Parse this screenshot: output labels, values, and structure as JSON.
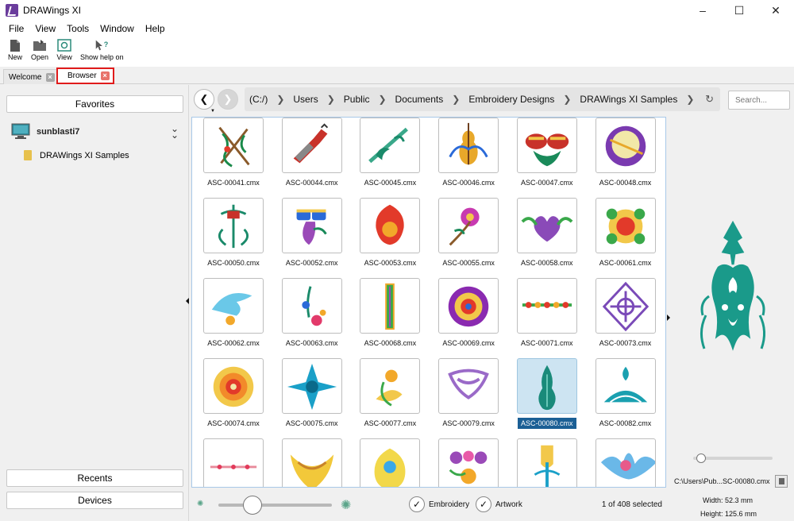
{
  "window": {
    "title": "DRAWings XI",
    "controls": [
      "minimize-icon",
      "maximize-icon",
      "close-icon"
    ]
  },
  "menu": [
    "File",
    "View",
    "Tools",
    "Window",
    "Help"
  ],
  "toolbar": {
    "new": "New",
    "open": "Open",
    "view": "View",
    "help": "Show help on"
  },
  "tabs": {
    "welcome": "Welcome",
    "browser": "Browser"
  },
  "left_panel": {
    "favorites": "Favorites",
    "computer": "sunblasti7",
    "folder": "DRAWings XI Samples",
    "recents": "Recents",
    "devices": "Devices"
  },
  "address": {
    "crumbs": [
      "(C:/)",
      "Users",
      "Public",
      "Documents",
      "Embroidery Designs",
      "DRAWings XI Samples"
    ],
    "search_placeholder": "Search..."
  },
  "files": [
    {
      "name": "ASC-00041.cmx",
      "selected": false
    },
    {
      "name": "ASC-00044.cmx",
      "selected": false
    },
    {
      "name": "ASC-00045.cmx",
      "selected": false
    },
    {
      "name": "ASC-00046.cmx",
      "selected": false
    },
    {
      "name": "ASC-00047.cmx",
      "selected": false
    },
    {
      "name": "ASC-00048.cmx",
      "selected": false
    },
    {
      "name": "ASC-00050.cmx",
      "selected": false
    },
    {
      "name": "ASC-00052.cmx",
      "selected": false
    },
    {
      "name": "ASC-00053.cmx",
      "selected": false
    },
    {
      "name": "ASC-00055.cmx",
      "selected": false
    },
    {
      "name": "ASC-00058.cmx",
      "selected": false
    },
    {
      "name": "ASC-00061.cmx",
      "selected": false
    },
    {
      "name": "ASC-00062.cmx",
      "selected": false
    },
    {
      "name": "ASC-00063.cmx",
      "selected": false
    },
    {
      "name": "ASC-00068.cmx",
      "selected": false
    },
    {
      "name": "ASC-00069.cmx",
      "selected": false
    },
    {
      "name": "ASC-00071.cmx",
      "selected": false
    },
    {
      "name": "ASC-00073.cmx",
      "selected": false
    },
    {
      "name": "ASC-00074.cmx",
      "selected": false
    },
    {
      "name": "ASC-00075.cmx",
      "selected": false
    },
    {
      "name": "ASC-00077.cmx",
      "selected": false
    },
    {
      "name": "ASC-00079.cmx",
      "selected": false
    },
    {
      "name": "ASC-00080.cmx",
      "selected": true
    },
    {
      "name": "ASC-00082.cmx",
      "selected": false
    },
    {
      "name": "",
      "selected": false
    },
    {
      "name": "",
      "selected": false
    },
    {
      "name": "",
      "selected": false
    },
    {
      "name": "",
      "selected": false
    },
    {
      "name": "",
      "selected": false
    },
    {
      "name": "",
      "selected": false
    }
  ],
  "bottom": {
    "embroidery": "Embroidery",
    "artwork": "Artwork",
    "count": "1 of 408 selected",
    "thumbnail_zoom": 0.3
  },
  "preview": {
    "path": "C:\\Users\\Pub...SC-00080.cmx",
    "width": "Width:  52.3 mm",
    "height": "Height:  125.6 mm",
    "zoom": 0.1
  },
  "colors": {
    "accent": "#1b5f95",
    "highlight": "#e01b1b",
    "teal": "#1a9a8a"
  }
}
